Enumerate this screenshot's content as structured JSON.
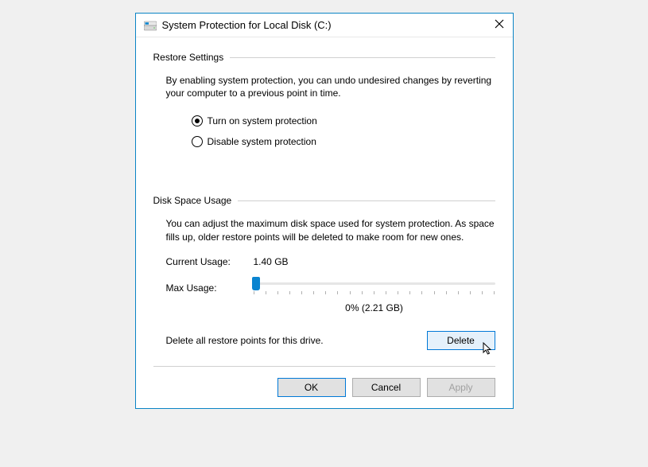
{
  "titlebar": {
    "title": "System Protection for Local Disk (C:)"
  },
  "restore": {
    "section_title": "Restore Settings",
    "description": "By enabling system protection, you can undo undesired changes by reverting your computer to a previous point in time.",
    "option_on": "Turn on system protection",
    "option_off": "Disable system protection"
  },
  "disk": {
    "section_title": "Disk Space Usage",
    "description": "You can adjust the maximum disk space used for system protection. As space fills up, older restore points will be deleted to make room for new ones.",
    "current_label": "Current Usage:",
    "current_value": "1.40 GB",
    "max_label": "Max Usage:",
    "slider_value": "0% (2.21 GB)",
    "delete_text": "Delete all restore points for this drive.",
    "delete_label": "Delete"
  },
  "footer": {
    "ok": "OK",
    "cancel": "Cancel",
    "apply": "Apply"
  }
}
